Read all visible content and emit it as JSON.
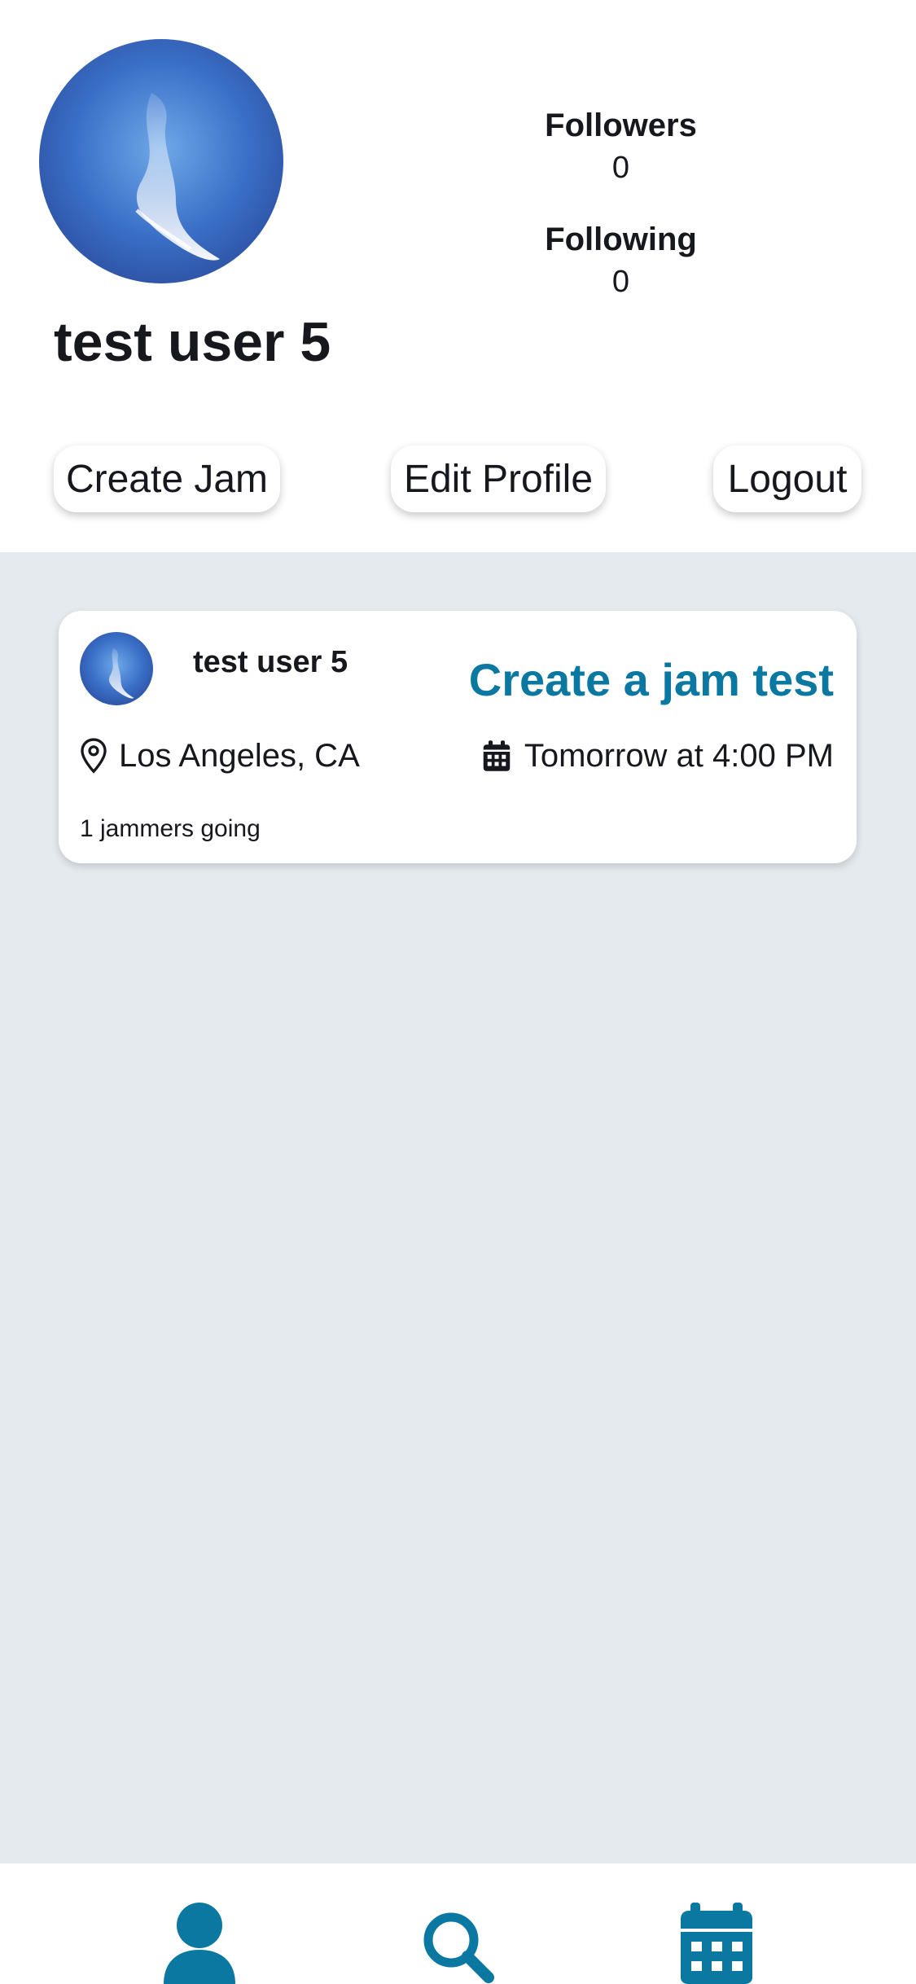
{
  "profile": {
    "name": "test user 5",
    "followers_label": "Followers",
    "followers_count": "0",
    "following_label": "Following",
    "following_count": "0"
  },
  "actions": {
    "create_jam": "Create Jam",
    "edit_profile": "Edit Profile",
    "logout": "Logout"
  },
  "feed": {
    "items": [
      {
        "user": "test user 5",
        "title": "Create a jam test",
        "location": "Los Angeles, CA",
        "time": "Tomorrow at 4:00 PM",
        "going": "1 jammers going"
      }
    ]
  },
  "tabbar": {
    "tabs": [
      {
        "icon": "person-icon",
        "active": true
      },
      {
        "icon": "search-icon",
        "active": false
      },
      {
        "icon": "calendar-icon",
        "active": false
      }
    ]
  },
  "colors": {
    "accent": "#0a78a0",
    "feed_background": "#e5eaef",
    "text": "#16181d"
  }
}
